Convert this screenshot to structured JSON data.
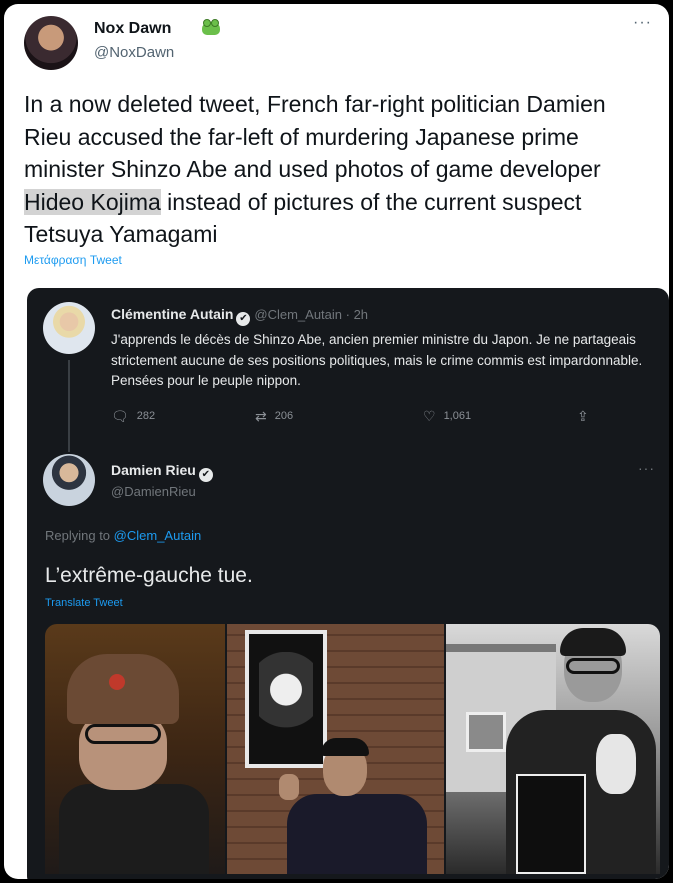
{
  "tweet": {
    "author_name": "Nox Dawn",
    "author_handle": "@NoxDawn",
    "more": "···",
    "text_before": "In a now deleted tweet, French far-right politician Damien Rieu accused the far-left of murdering Japanese prime minister Shinzo Abe and used photos of game developer ",
    "text_highlight": "Hideo Kojima",
    "text_after": " instead of pictures of the current suspect Tetsuya Yamagami",
    "translate": "Μετάφραση Tweet"
  },
  "quote": {
    "original": {
      "name": "Clémentine Autain",
      "handle_time": "@Clem_Autain · 2h",
      "text": "J'apprends le décès de Shinzo Abe, ancien premier ministre du Japon. Je ne partageais strictement aucune de ses positions politiques, mais le crime commis est impardonnable. Pensées pour le peuple nippon.",
      "reply_count": "282",
      "retweet_count": "206",
      "like_count": "1,061"
    },
    "reply": {
      "name": "Damien Rieu",
      "handle": "@DamienRieu",
      "more": "···",
      "replying_prefix": "Replying to ",
      "replying_mention": "@Clem_Autain",
      "text": "L’extrême-gauche tue.",
      "translate": "Translate Tweet"
    }
  },
  "icons": {
    "verified": "✔",
    "reply": "🗨",
    "retweet": "⇄",
    "like": "♡",
    "share": "⇪"
  }
}
